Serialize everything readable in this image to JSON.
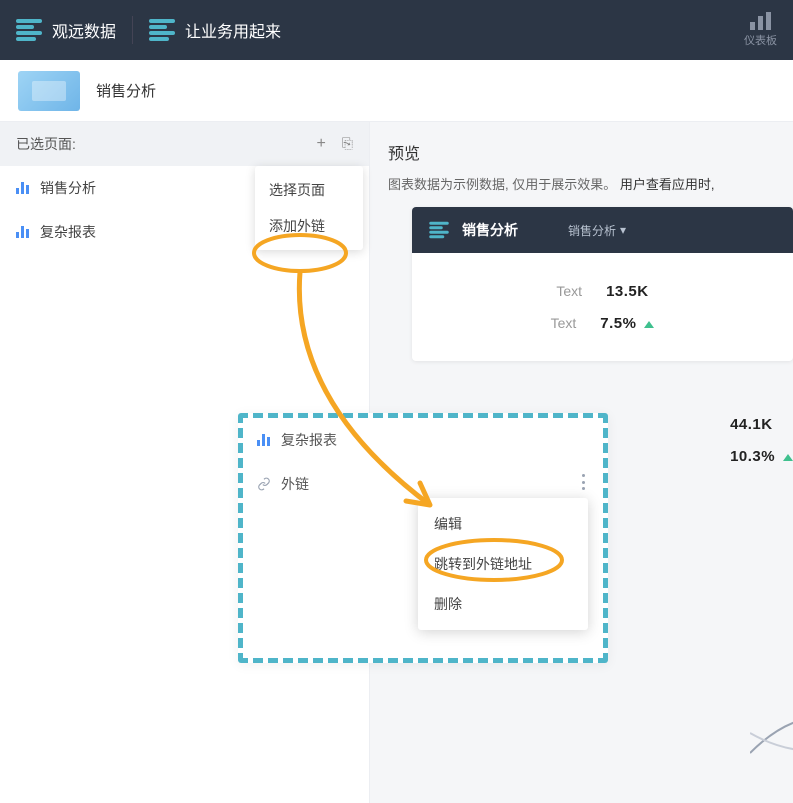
{
  "topbar": {
    "brand": "观远数据",
    "slogan": "让业务用起来",
    "right_label": "仪表板"
  },
  "crumb": {
    "title": "销售分析"
  },
  "sidebar": {
    "head": "已选页面:",
    "items": [
      {
        "label": "销售分析"
      },
      {
        "label": "复杂报表"
      }
    ],
    "plus_menu": [
      "选择页面",
      "添加外链"
    ]
  },
  "preview": {
    "title": "预览",
    "note_prefix": "图表数据为示例数据, 仅用于展示效果。",
    "note_bold": "用户查看应用时, ",
    "card": {
      "title": "销售分析",
      "dropdown": "销售分析",
      "rows": [
        {
          "k": "Text",
          "v": "13.5K"
        },
        {
          "k": "Text",
          "v": "7.5%"
        }
      ]
    },
    "partial": {
      "v1": "44.1K",
      "v2": "10.3%"
    }
  },
  "dashbox": {
    "item1": "复杂报表",
    "item2": "外链",
    "ctx": [
      "编辑",
      "跳转到外链地址",
      "删除"
    ]
  }
}
